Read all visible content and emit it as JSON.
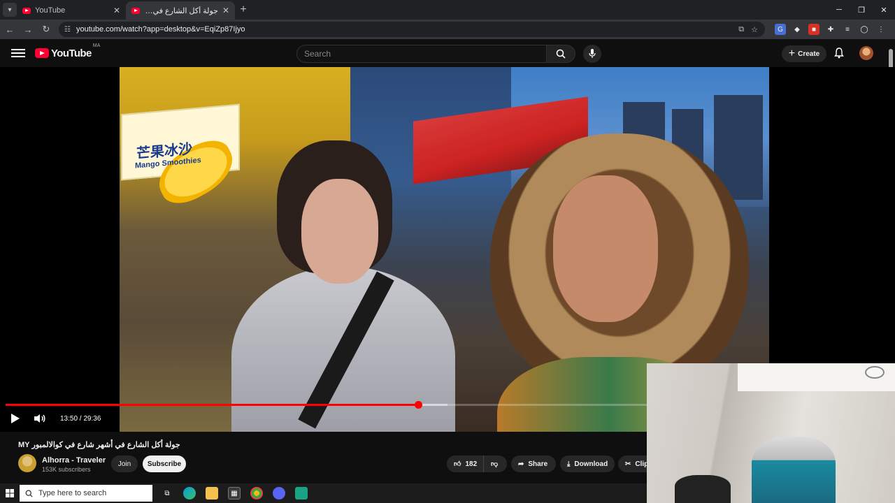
{
  "browser": {
    "tabs": [
      {
        "title": "YouTube",
        "active": false
      },
      {
        "title": "جولة أكل الشارع في أشهر شارع",
        "active": true
      }
    ],
    "url": "youtube.com/watch?app=desktop&v=EqiZp87Ijyo"
  },
  "youtube": {
    "logo_text": "YouTube",
    "region": "MA",
    "search_placeholder": "Search",
    "create_label": "Create"
  },
  "player": {
    "time": "13:50 / 29:36",
    "progress": 0.467,
    "buffered": 0.5,
    "video_sign_cn": "芒果冰沙",
    "video_sign_en": "Mango Smoothies"
  },
  "video": {
    "title": "جولة أكل الشارع في أشهر شارع في كوالالمبور MY",
    "channel": "Alhorra - Traveler",
    "subscribers": "153K subscribers",
    "join_label": "Join",
    "subscribe_label": "Subscribe",
    "likes": "182",
    "share_label": "Share",
    "download_label": "Download",
    "clip_label": "Clip"
  },
  "taskbar": {
    "search_placeholder": "Type here to search"
  },
  "colors": {
    "accent": "#ff0000",
    "background": "#0f0f0f"
  }
}
